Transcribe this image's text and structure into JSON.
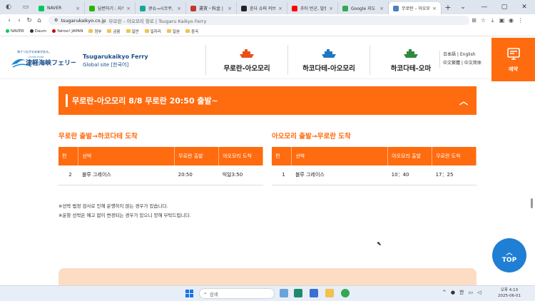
{
  "browser": {
    "tabs": [
      {
        "label": "NAVER",
        "color": "#03c75a",
        "active": false
      },
      {
        "label": "답변하기 : 지식iN",
        "color": "#2db400",
        "active": false
      },
      {
        "label": "큐슈→시코쿠, 혼슈",
        "color": "#14a89a",
        "active": false
      },
      {
        "label": "運賃・料金 | 商港",
        "color": "#c0392b",
        "active": false
      },
      {
        "label": "혼다 슈퍼 커브 11",
        "color": "#222222",
        "active": false
      },
      {
        "label": "추티 반군, 말렸던",
        "color": "#ff0000",
        "active": false
      },
      {
        "label": "Google 지도",
        "color": "#34a853",
        "active": false
      },
      {
        "label": "무로란 – 아오모리",
        "color": "#4a7fc1",
        "active": true
      }
    ],
    "new_tab": "+",
    "window_controls": [
      "⌄",
      "—",
      "▢",
      "✕"
    ],
    "url_domain": "tsugarukaikyo.co.jp",
    "url_title": "무로란 – 아오모리 항로 | Tsugaru Kaikyo Ferry",
    "bookmarks": [
      {
        "label": "NAVER",
        "type": "site"
      },
      {
        "label": "Daum",
        "type": "site"
      },
      {
        "label": "Yahoo! JAPAN",
        "type": "site"
      },
      {
        "label": "정부",
        "type": "folder"
      },
      {
        "label": "금융",
        "type": "folder"
      },
      {
        "label": "일반",
        "type": "folder"
      },
      {
        "label": "일자리",
        "type": "folder"
      },
      {
        "label": "일본",
        "type": "folder"
      },
      {
        "label": "중국",
        "type": "folder"
      }
    ]
  },
  "header": {
    "logo_tagline": "海でつながる未来がある。",
    "logo_small": "Ocean Road",
    "logo_main": "津軽海峡フェリー",
    "brand_name": "Tsugarukaikyo Ferry",
    "brand_sub": "Global site [한국어]",
    "routes": [
      {
        "label": "무로란-아오모리",
        "color": "#e8501a"
      },
      {
        "label": "하코다테-아오모리",
        "color": "#1f77c4"
      },
      {
        "label": "하코다테-오마",
        "color": "#2e8b3d"
      }
    ],
    "lang_links": [
      "日本語",
      "English",
      "中文繁體",
      "中文简体"
    ],
    "reserve_label": "예약"
  },
  "accordion": {
    "title": "무로란-아오모리   8/8 무로란 20:50 출발~",
    "chevron": "︿"
  },
  "left_table": {
    "title": "무로란 출발→하코다테 도착",
    "headers": [
      "편",
      "선박",
      "무로란 출발",
      "아오모리 도착"
    ],
    "rows": [
      [
        "2",
        "블루 그레이스",
        "20:50",
        "익일3:50"
      ]
    ]
  },
  "right_table": {
    "title": "아오모리 출발→무로란 도착",
    "headers": [
      "편",
      "선박",
      "아오모리 출발",
      "무로란 도착"
    ],
    "rows": [
      [
        "1",
        "블루 그레이스",
        "10：40",
        "17：25"
      ]
    ]
  },
  "notes": [
    "※선박 법정 검사로 인해 운행하지 않는 경우가 있습니다.",
    "※운항 선박은 예고 없이 변경되는 경우가 있으니 양해 부탁드립니다."
  ],
  "top_button": {
    "arrow": "︿",
    "label": "TOP"
  },
  "taskbar": {
    "search_placeholder": "검색",
    "tray_ime": "한",
    "time": "오후 4:13",
    "date": "2025-06-01"
  }
}
